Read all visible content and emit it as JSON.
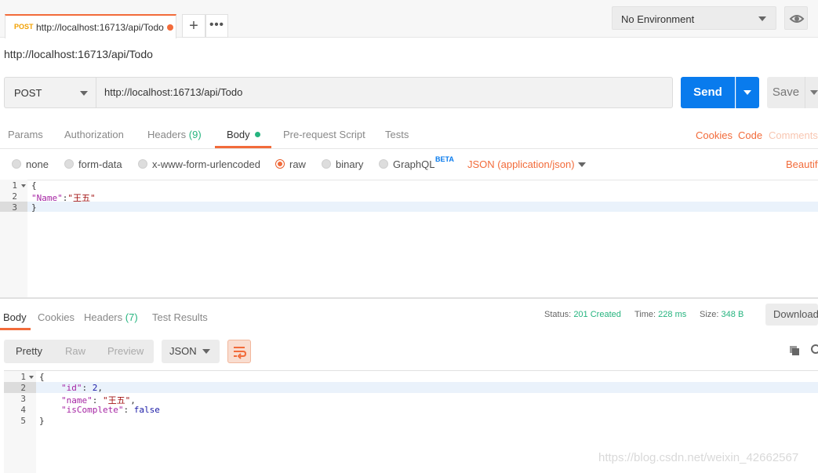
{
  "tab": {
    "method": "POST",
    "url": "http://localhost:16713/api/Todo",
    "new_tab": "+",
    "more": "•••"
  },
  "environment": {
    "selected": "No Environment"
  },
  "request": {
    "title": "http://localhost:16713/api/Todo",
    "method": "POST",
    "url": "http://localhost:16713/api/Todo",
    "send_label": "Send",
    "save_label": "Save",
    "tabs": {
      "params": "Params",
      "authorization": "Authorization",
      "headers": "Headers",
      "headers_count": "(9)",
      "body": "Body",
      "prerequest": "Pre-request Script",
      "tests": "Tests"
    },
    "links": {
      "cookies": "Cookies",
      "code": "Code",
      "comments": "Comments"
    },
    "body_types": {
      "none": "none",
      "form_data": "form-data",
      "urlencoded": "x-www-form-urlencoded",
      "raw": "raw",
      "binary": "binary",
      "graphql": "GraphQL",
      "graphql_badge": "BETA"
    },
    "body_type_selected": "raw",
    "content_type": "JSON (application/json)",
    "beautify": "Beautify",
    "editor": {
      "line_numbers": [
        "1",
        "2",
        "3"
      ],
      "l1": "{",
      "l2_key": "\"Name\"",
      "l2_colon": ":",
      "l2_val": "\"王五\"",
      "l3": "}"
    }
  },
  "response": {
    "tabs": {
      "body": "Body",
      "cookies": "Cookies",
      "headers": "Headers",
      "headers_count": "(7)",
      "test_results": "Test Results"
    },
    "status_label": "Status:",
    "status_value": "201 Created",
    "time_label": "Time:",
    "time_value": "228 ms",
    "size_label": "Size:",
    "size_value": "348 B",
    "download_label": "Download",
    "views": {
      "pretty": "Pretty",
      "raw": "Raw",
      "preview": "Preview"
    },
    "format": "JSON",
    "editor": {
      "line_numbers": [
        "1",
        "2",
        "3",
        "4",
        "5"
      ],
      "l1": "{",
      "l2_key": "\"id\"",
      "l2_rest": ": ",
      "l2_val": "2",
      "l2_end": ",",
      "l3_key": "\"name\"",
      "l3_rest": ": ",
      "l3_val": "\"王五\"",
      "l3_end": ",",
      "l4_key": "\"isComplete\"",
      "l4_rest": ": ",
      "l4_val": "false",
      "l5": "}"
    }
  },
  "watermark": "https://blog.csdn.net/weixin_42662567",
  "colors": {
    "accent": "#f26b3a",
    "send": "#097bed",
    "success": "#26b47f"
  }
}
